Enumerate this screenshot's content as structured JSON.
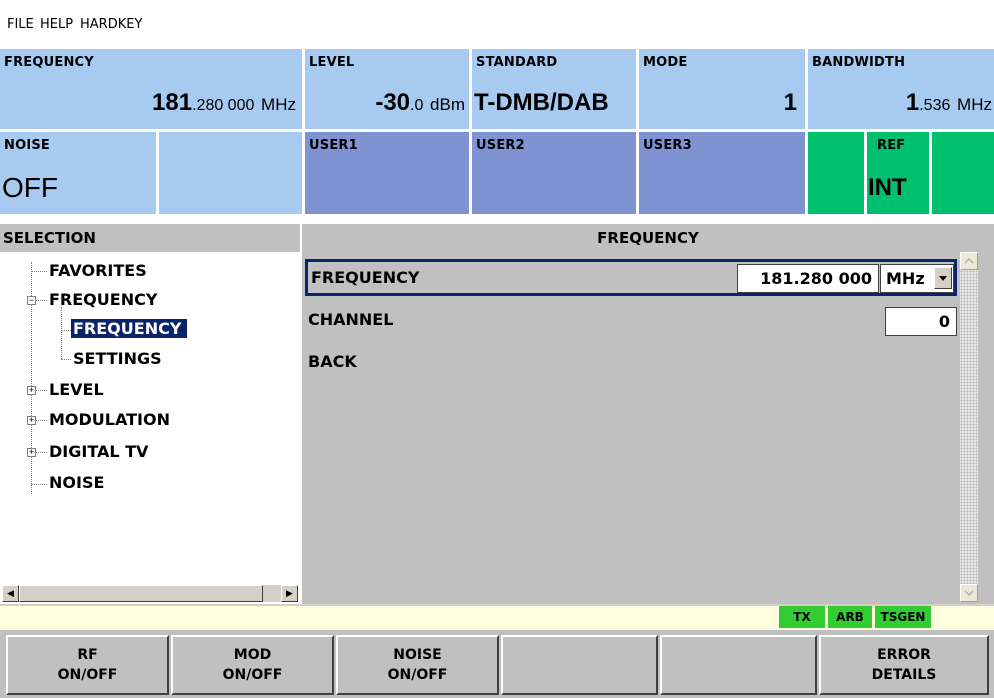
{
  "menu": {
    "file": "FILE",
    "help": "HELP",
    "hardkey": "HARDKEY"
  },
  "status": {
    "frequency": {
      "label": "FREQUENCY",
      "main": "181",
      "frac": ".280 000",
      "unit": "MHz"
    },
    "level": {
      "label": "LEVEL",
      "main": "-30",
      "frac": ".0",
      "unit": "dBm"
    },
    "standard": {
      "label": "STANDARD",
      "value": "T-DMB/DAB"
    },
    "mode": {
      "label": "MODE",
      "value": "1"
    },
    "bandwidth": {
      "label": "BANDWIDTH",
      "main": "1",
      "frac": ".536",
      "unit": "MHz"
    },
    "noise": {
      "label": "NOISE",
      "value": "OFF"
    },
    "user1": {
      "label": "USER1"
    },
    "user2": {
      "label": "USER2"
    },
    "user3": {
      "label": "USER3"
    },
    "ref": {
      "label": "REF",
      "value": "INT"
    }
  },
  "colors": {
    "status_blue": "#a6caf0",
    "user_blue": "#7f92d2",
    "ref_green": "#00c070",
    "selection": "#0a246a",
    "panel_gray": "#c0c0c0",
    "flag_green": "#33cc33"
  },
  "selection": {
    "header": "SELECTION",
    "tree": {
      "favorites": "FAVORITES",
      "frequency": "FREQUENCY",
      "frequency_child": "FREQUENCY",
      "settings": "SETTINGS",
      "level": "LEVEL",
      "modulation": "MODULATION",
      "digital_tv": "DIGITAL TV",
      "noise": "NOISE"
    }
  },
  "main": {
    "header": "FREQUENCY",
    "frequency_label": "FREQUENCY",
    "frequency_value": "181.280 000",
    "frequency_unit": "MHz",
    "channel_label": "CHANNEL",
    "channel_value": "0",
    "back_label": "BACK"
  },
  "flags": {
    "tx": "TX",
    "arb": "ARB",
    "tsgen": "TSGEN"
  },
  "softkeys": {
    "rf": {
      "line1": "RF",
      "line2": "ON/OFF"
    },
    "mod": {
      "line1": "MOD",
      "line2": "ON/OFF"
    },
    "noise": {
      "line1": "NOISE",
      "line2": "ON/OFF"
    },
    "error": {
      "line1": "ERROR",
      "line2": "DETAILS"
    }
  }
}
